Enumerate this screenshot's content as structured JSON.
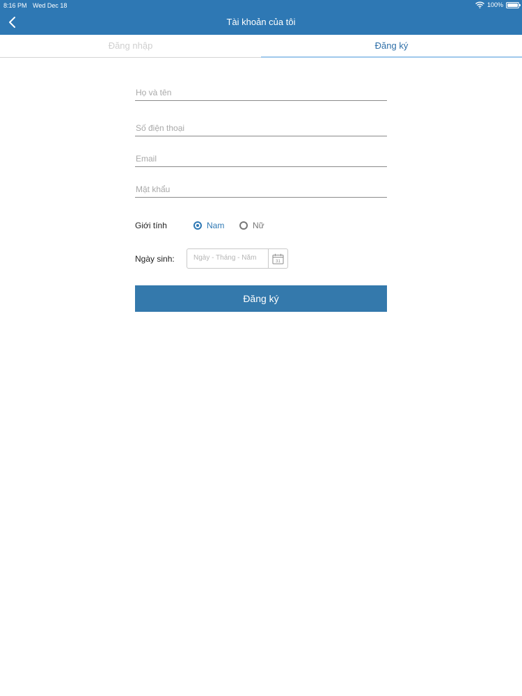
{
  "status_bar": {
    "time": "8:16 PM",
    "date": "Wed Dec 18",
    "battery": "100%"
  },
  "nav": {
    "title": "Tài khoản của tôi",
    "back_icon": "chevron-left-icon"
  },
  "tabs": [
    {
      "label": "Đăng nhập",
      "active": false
    },
    {
      "label": "Đăng ký",
      "active": true
    }
  ],
  "form": {
    "fullname": {
      "placeholder": "Họ và tên",
      "value": ""
    },
    "phone": {
      "placeholder": "Số điện thoại",
      "value": ""
    },
    "email": {
      "placeholder": "Email",
      "value": ""
    },
    "password": {
      "placeholder": "Mật khẩu",
      "value": ""
    },
    "gender": {
      "label": "Giới tính",
      "options": [
        {
          "label": "Nam",
          "selected": true
        },
        {
          "label": "Nữ",
          "selected": false
        }
      ]
    },
    "birthday": {
      "label": "Ngày sinh:",
      "placeholder": "Ngày - Tháng - Năm",
      "calendar_icon": "calendar-icon",
      "calendar_day": "31"
    },
    "submit_label": "Đăng ký"
  },
  "colors": {
    "primary": "#2e78b4",
    "button": "#3479ac",
    "active_tab_text": "#2e6fa8",
    "inactive_tab_text": "#cfcfcf"
  }
}
